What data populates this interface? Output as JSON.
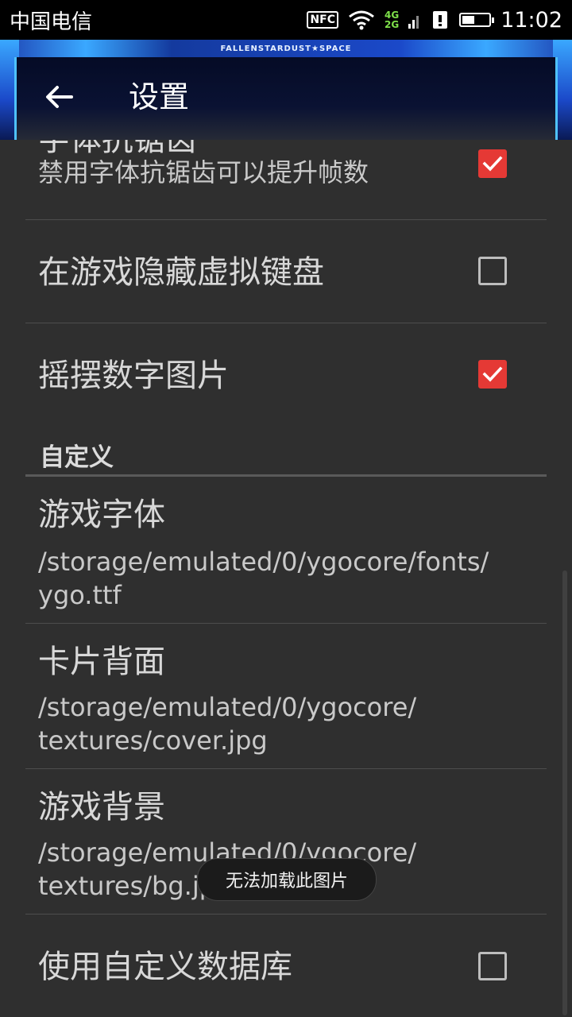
{
  "status_bar": {
    "carrier": "中国电信",
    "nfc": "NFC",
    "net_top": "4G",
    "net_bottom": "2G",
    "battery_level": 0.45,
    "time": "11:02"
  },
  "app_bar": {
    "brand": "FALLENSTARDUST★SPACE",
    "title": "设置",
    "back_icon": "arrow-left-icon"
  },
  "settings": {
    "font_antialias": {
      "label": "字体抗锯齿",
      "summary": "禁用字体抗锯齿可以提升帧数",
      "checked": true
    },
    "hide_keyboard": {
      "label": "在游戏隐藏虚拟键盘",
      "checked": false
    },
    "wobble_digits": {
      "label": "摇摆数字图片",
      "checked": true
    },
    "custom_section": "自定义",
    "game_font": {
      "label": "游戏字体",
      "summary_line1": "/storage/emulated/0/ygocore/fonts/",
      "summary_line2": "ygo.ttf"
    },
    "card_back": {
      "label": "卡片背面",
      "summary_line1": "/storage/emulated/0/ygocore/",
      "summary_line2": "textures/cover.jpg"
    },
    "game_background": {
      "label": "游戏背景",
      "summary_line1": "/storage/emulated/0/ygocore/",
      "summary_line2": "textures/bg.jpg"
    },
    "custom_database": {
      "label": "使用自定义数据库",
      "checked": false
    }
  },
  "toast": {
    "text": "无法加载此图片"
  },
  "colors": {
    "accent": "#e53935",
    "background": "#2f2f2f"
  }
}
